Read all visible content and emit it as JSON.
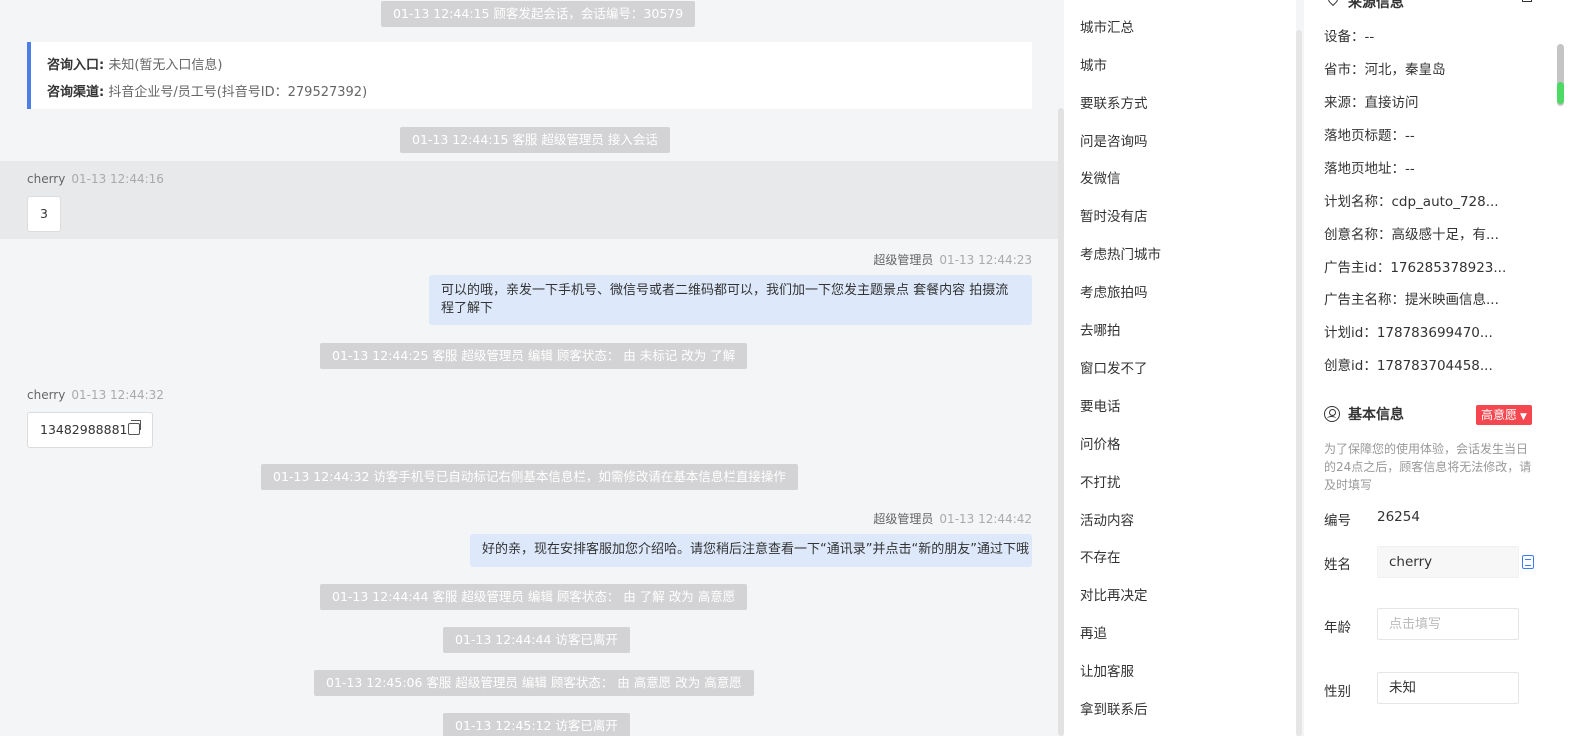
{
  "chat": {
    "system_messages": [
      "01-13 12:44:15 顾客发起会话，会话编号：30579",
      "01-13 12:44:15 客服 超级管理员 接入会话",
      "01-13 12:44:25 客服 超级管理员 编辑 顾客状态： 由 未标记 改为 了解",
      "01-13 12:44:32 访客手机号已自动标记右侧基本信息栏，如需修改请在基本信息栏直接操作",
      "01-13 12:44:44 客服 超级管理员 编辑 顾客状态： 由 了解 改为 高意愿",
      "01-13 12:44:44 访客已离开",
      "01-13 12:45:06 客服 超级管理员 编辑 顾客状态： 由 高意愿 改为 高意愿",
      "01-13 12:45:12 访客已离开"
    ],
    "source": {
      "entry_label": "咨询入口:",
      "entry_value": "未知(暂无入口信息)",
      "channel_label": "咨询渠道:",
      "channel_value": "抖音企业号/员工号(抖音号ID：279527392)"
    },
    "messages": [
      {
        "sender": "cherry",
        "time": "01-13 12:44:16",
        "text": "3"
      },
      {
        "sender": "超级管理员",
        "time": "01-13 12:44:23",
        "text": "可以的哦，亲发一下手机号、微信号或者二维码都可以，我们加一下您发主题景点 套餐内容 拍摄流程了解下"
      },
      {
        "sender": "cherry",
        "time": "01-13 12:44:32",
        "text": "13482988881"
      },
      {
        "sender": "超级管理员",
        "time": "01-13 12:44:42",
        "text": "好的亲，现在安排客服加您介绍哈。请您稍后注意查看一下“通讯录”并点击“新的朋友”通过下哦"
      }
    ]
  },
  "quick_replies": [
    "城市汇总",
    "城市",
    "要联系方式",
    "问是咨询吗",
    "发微信",
    "暂时没有店",
    "考虑热门城市",
    "考虑旅拍吗",
    "去哪拍",
    "窗口发不了",
    "要电话",
    "问价格",
    "不打扰",
    "活动内容",
    "不存在",
    "对比再决定",
    "再追",
    "让加客服",
    "拿到联系后"
  ],
  "info": {
    "top_section_title": "来源信息",
    "ad_rows": [
      "设备：--",
      "省市：河北，秦皇岛",
      "来源：直接访问",
      "落地页标题：--",
      "落地页地址：--",
      "计划名称：cdp_auto_728...",
      "创意名称：高级感十足，有...",
      "广告主id：176285378923...",
      "广告主名称：提米映画信息...",
      "计划id：178783699470...",
      "创意id：178783704458..."
    ],
    "basic_title": "基本信息",
    "intent_badge": "高意愿",
    "notice": "为了保障您的使用体验，会话发生当日的24点之后，顾客信息将无法修改，请及时填写",
    "fields": {
      "id_label": "编号",
      "id_value": "26254",
      "name_label": "姓名",
      "name_value": "cherry",
      "age_label": "年龄",
      "age_placeholder": "点击填写",
      "gender_label": "性别",
      "gender_value": "未知"
    },
    "colors": {
      "accent": "#4d7ee8",
      "badge": "#f5474f",
      "bubble": "#dde9fb"
    }
  }
}
